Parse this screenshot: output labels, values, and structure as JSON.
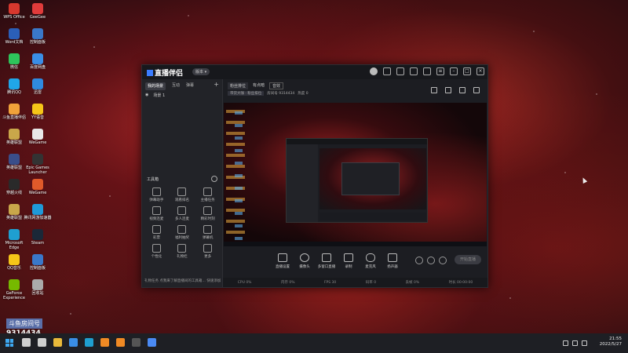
{
  "desktop": {
    "icons": [
      {
        "label": "WPS Office",
        "color": "#d8382e"
      },
      {
        "label": "GeeGee",
        "color": "#e03b3b"
      },
      {
        "label": "Word文档",
        "color": "#2b5fb8"
      },
      {
        "label": "控制面板",
        "color": "#3a78c9"
      },
      {
        "label": "微信",
        "color": "#2ec45b"
      },
      {
        "label": "百度网盘",
        "color": "#3a8ee6"
      },
      {
        "label": "腾讯QQ",
        "color": "#20a6e8"
      },
      {
        "label": "迅雷",
        "color": "#2f8ae0"
      },
      {
        "label": "斗鱼直播伴侣",
        "color": "#f0a23a"
      },
      {
        "label": "YY语音",
        "color": "#f5c518"
      },
      {
        "label": "英雄联盟",
        "color": "#c9a74a"
      },
      {
        "label": "WeGame",
        "color": "#e8e8e8"
      },
      {
        "label": "英雄联盟",
        "color": "#3a4e8a"
      },
      {
        "label": "Epic Games Launcher",
        "color": "#333333"
      },
      {
        "label": "穿越火线",
        "color": "#2a2a2a"
      },
      {
        "label": "WeGame",
        "color": "#e05a2a"
      },
      {
        "label": "英雄联盟",
        "color": "#c9a74a"
      },
      {
        "label": "腾讯网游加速器",
        "color": "#1f9ad8"
      },
      {
        "label": "Microsoft Edge",
        "color": "#1f9fd0"
      },
      {
        "label": "Steam",
        "color": "#1b2838"
      },
      {
        "label": "QQ音乐",
        "color": "#f5c518"
      },
      {
        "label": "控制面板",
        "color": "#3a78c9"
      },
      {
        "label": "GeForce Experience",
        "color": "#76b900"
      },
      {
        "label": "回收站",
        "color": "#aaaaaa"
      }
    ],
    "watermark": {
      "text": "斗鱼房间号",
      "number": "9314434"
    }
  },
  "app": {
    "title": "直播伴侣",
    "version_badge": "版本 ▾",
    "titlebar_icons": [
      "avatar",
      "message-icon",
      "chat-icon",
      "gift-icon",
      "shirt-icon",
      "menu-icon",
      "minimize-icon",
      "maximize-icon",
      "close-icon"
    ],
    "left": {
      "tabs": [
        "我的场景",
        "互动",
        "弹幕"
      ],
      "active_tab": "我的场景",
      "add_label": "+",
      "scene_name": "场景 1",
      "tools_title": "工具箱",
      "tools": [
        {
          "label": "弹幕助手"
        },
        {
          "label": "观看排名"
        },
        {
          "label": "主播任务"
        },
        {
          "label": "视频连麦"
        },
        {
          "label": "多人连麦"
        },
        {
          "label": "精彩时刻"
        },
        {
          "label": "彩票"
        },
        {
          "label": "福利抽奖"
        },
        {
          "label": "弹幕机"
        },
        {
          "label": "个性化"
        },
        {
          "label": "礼物栏"
        },
        {
          "label": "更多"
        }
      ],
      "footer": "礼物任务   点我来了解直播间的工具箱… 快速添加"
    },
    "main": {
      "tabs": [
        "粉丝排位",
        "有点暗",
        "音效"
      ],
      "info": [
        "带货大咖 · 粉丝排位",
        "房间号 9314434",
        "热度 0"
      ],
      "controls": [
        "直播设置",
        "摄像头",
        "多窗口直播",
        "录制",
        "麦克风",
        "扬声器"
      ],
      "go_live": "开始直播",
      "status": [
        "CPU 0%",
        "内存 0%",
        "FPS 30",
        "码率 0",
        "丢帧 0%",
        "时长 00:00:00"
      ]
    }
  },
  "taskbar": {
    "time": "21:55",
    "date": "2022/5/27",
    "apps": [
      "search-icon",
      "task-view-icon",
      "file-explorer-icon",
      "store-icon",
      "edge-icon",
      "douyu-icon",
      "douyu-icon",
      "obs-icon",
      "chrome-icon"
    ]
  }
}
